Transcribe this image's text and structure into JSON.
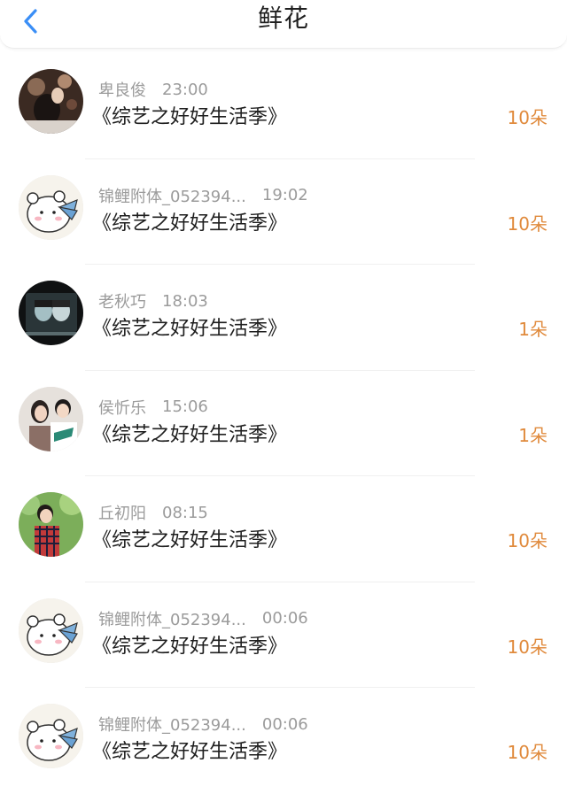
{
  "header": {
    "title": "鲜花",
    "back_icon": "chevron-left-icon",
    "accent": "#3a8ef6"
  },
  "colors": {
    "count": "#e08a3c",
    "meta": "#9b9b9b"
  },
  "rows": [
    {
      "name": "卑良俊",
      "time": "23:00",
      "show": "《综艺之好好生活季》",
      "count": "10朵",
      "avatar": "photo-night-avatar"
    },
    {
      "name": "锦鲤附体_052394...",
      "time": "19:02",
      "show": "《综艺之好好生活季》",
      "count": "10朵",
      "avatar": "cartoon-bear-avatar"
    },
    {
      "name": "老秋巧",
      "time": "18:03",
      "show": "《综艺之好好生活季》",
      "count": "1朵",
      "avatar": "photo-couple-avatar"
    },
    {
      "name": "侯忻乐",
      "time": "15:06",
      "show": "《综艺之好好生活季》",
      "count": "1朵",
      "avatar": "photo-pair-avatar"
    },
    {
      "name": "丘初阳",
      "time": "08:15",
      "show": "《综艺之好好生活季》",
      "count": "10朵",
      "avatar": "photo-boy-avatar"
    },
    {
      "name": "锦鲤附体_052394...",
      "time": "00:06",
      "show": "《综艺之好好生活季》",
      "count": "10朵",
      "avatar": "cartoon-bear-avatar"
    },
    {
      "name": "锦鲤附体_052394...",
      "time": "00:06",
      "show": "《综艺之好好生活季》",
      "count": "10朵",
      "avatar": "cartoon-bear-avatar"
    }
  ]
}
